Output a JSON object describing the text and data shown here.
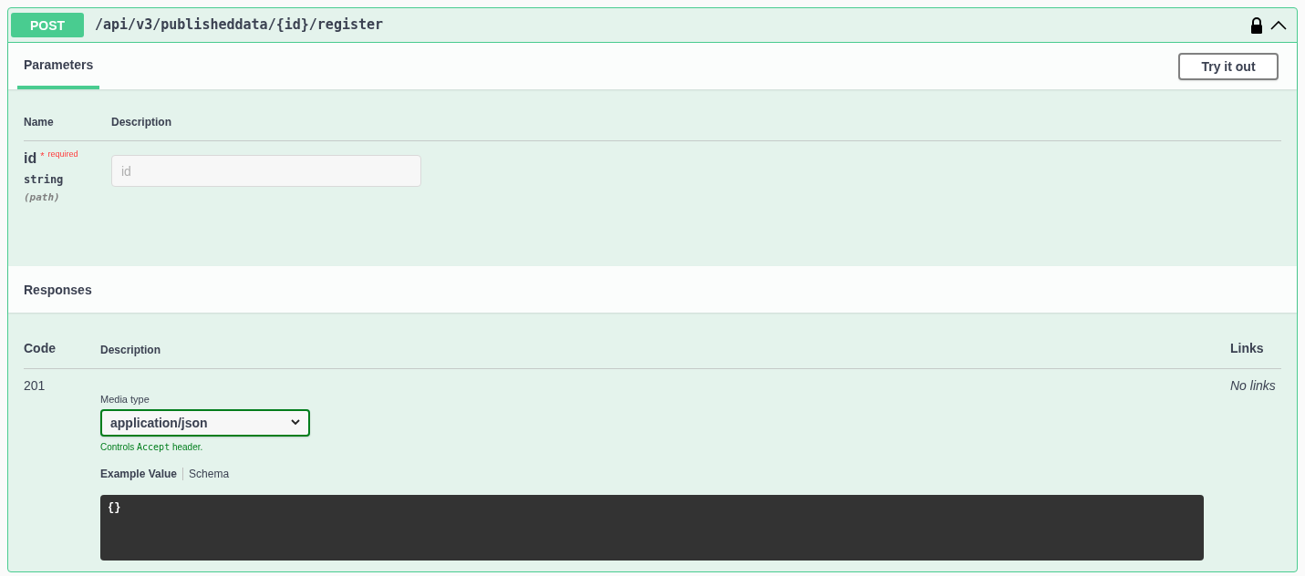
{
  "operation": {
    "method": "POST",
    "path": "/api/v3/publisheddata/{id}/register",
    "locked": true,
    "expanded": true
  },
  "tabs": [
    {
      "label": "Parameters",
      "selected": true
    }
  ],
  "try_button": "Try it out",
  "parameters": {
    "columns": [
      "Name",
      "Description"
    ],
    "rows": [
      {
        "name": "id",
        "required_mark": "*",
        "required": "required",
        "type": "string",
        "location": "(path)",
        "placeholder": "id"
      }
    ]
  },
  "responses": {
    "title": "Responses",
    "columns": [
      "Code",
      "Description",
      "Links"
    ],
    "rows": [
      {
        "code": "201",
        "media_label": "Media type",
        "media_value": "application/json",
        "hint": [
          "Controls",
          "Accept",
          "header."
        ],
        "example_tabs": [
          {
            "label": "Example Value",
            "selected": true
          },
          {
            "label": "Schema",
            "selected": false
          }
        ],
        "example": "{}",
        "links": "No links"
      }
    ]
  }
}
